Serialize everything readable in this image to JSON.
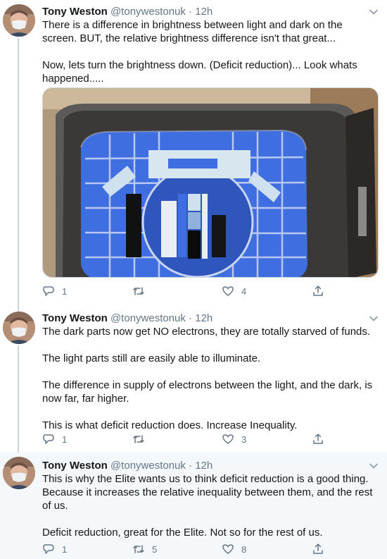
{
  "tweets": [
    {
      "author": {
        "name": "Tony Weston",
        "handle": "@tonywestonuk"
      },
      "separator": "·",
      "time": "12h",
      "paragraphs": [
        "There is a difference in brightness between light and dark on the screen. BUT, the relative brightness difference isn't that great...",
        "Now, lets turn the brightness down. (Deficit reduction)... Look whats happened....."
      ],
      "stats": {
        "replies": "1",
        "retweets": "",
        "likes": "4"
      }
    },
    {
      "author": {
        "name": "Tony Weston",
        "handle": "@tonywestonuk"
      },
      "separator": "·",
      "time": "12h",
      "paragraphs": [
        "The dark parts now get NO electrons, they are totally starved of funds.",
        "The light parts still are easily able to illuminate.",
        "The difference in supply of electrons between the light, and the dark, is now far, far higher.",
        "This is what deficit reduction does. Increase Inequality."
      ],
      "stats": {
        "replies": "1",
        "retweets": "",
        "likes": "3"
      }
    },
    {
      "author": {
        "name": "Tony Weston",
        "handle": "@tonywestonuk"
      },
      "separator": "·",
      "time": "12h",
      "paragraphs": [
        "This is why the Elite wants us to think deficit reduction is a good thing. Because it increases the relative inequality between them, and the rest of us.",
        "Deficit reduction, great for the Elite. Not so for the rest of us."
      ],
      "stats": {
        "replies": "1",
        "retweets": "5",
        "likes": "8"
      }
    }
  ],
  "colors": {
    "text": "#14171a",
    "muted": "#657786",
    "thread": "#ccd6dd",
    "highlight_bg": "#f5f8fa",
    "screen_blue": "#3f6ee0"
  },
  "icons": {
    "reply": "reply-icon",
    "retweet": "retweet-icon",
    "like": "like-icon",
    "share": "share-icon",
    "more": "chevron-down-icon"
  }
}
